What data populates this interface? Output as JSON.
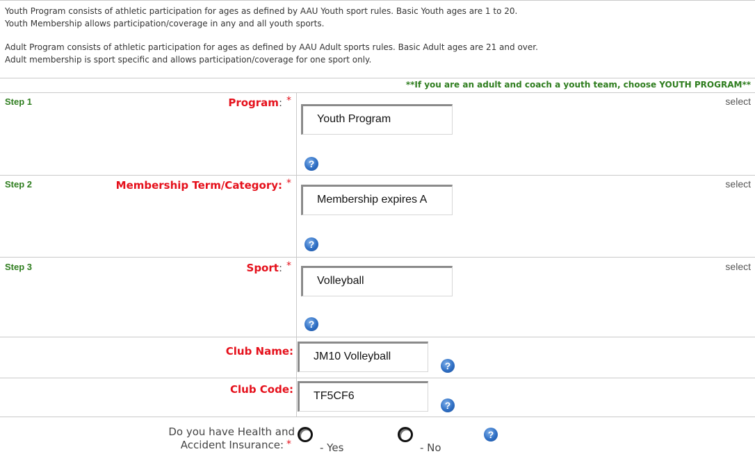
{
  "intro": {
    "youth_line1": "Youth Program consists of athletic participation for ages as defined by AAU Youth sport rules. Basic Youth ages are 1 to 20.",
    "youth_line2": "Youth Membership allows participation/coverage in any and all youth sports.",
    "adult_line1": "Adult Program consists of athletic participation for ages as defined by AAU Adult sports rules. Basic Adult ages are 21 and over.",
    "adult_line2": "Adult membership is sport specific and allows participation/coverage for one sport only."
  },
  "notice": "**If you are an adult and coach a youth team, choose YOUTH PROGRAM**",
  "steps": {
    "step1": {
      "step": "Step 1",
      "label": "Program",
      "colon": ":",
      "value": "Youth Program",
      "select": "select"
    },
    "step2": {
      "step": "Step 2",
      "label": "Membership Term/Category:",
      "value": "Membership expires A",
      "select": "select"
    },
    "step3": {
      "step": "Step 3",
      "label": "Sport",
      "colon": ":",
      "value": "Volleyball",
      "select": "select"
    }
  },
  "required_mark": "*",
  "club": {
    "name_label": "Club Name:",
    "name_value": "JM10 Volleyball",
    "code_label": "Club Code:",
    "code_value": "TF5CF6"
  },
  "insurance": {
    "question_line1": "Do you have Health and",
    "question_line2": "Accident Insurance:",
    "yes_label": "- Yes",
    "no_label": "- No"
  },
  "help_glyph": "?",
  "icons": [
    "help-icon",
    "radio-button"
  ]
}
